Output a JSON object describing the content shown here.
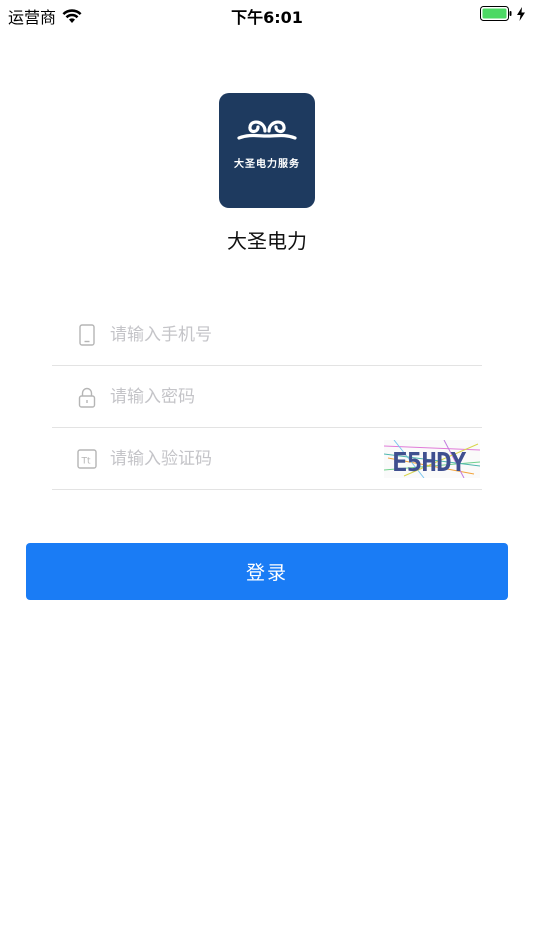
{
  "status_bar": {
    "carrier": "运营商",
    "time": "下午6:01",
    "battery_color": "#4cd964"
  },
  "logo": {
    "tagline": "大圣电力服务",
    "bg_color": "#1e3a5f"
  },
  "app_name": "大圣电力",
  "form": {
    "phone": {
      "placeholder": "请输入手机号",
      "icon": "phone-icon"
    },
    "password": {
      "placeholder": "请输入密码",
      "icon": "lock-icon"
    },
    "captcha": {
      "placeholder": "请输入验证码",
      "icon": "text-icon",
      "code": "E5HDY"
    }
  },
  "login_button": {
    "label": "登录",
    "color": "#1a7cf5"
  }
}
